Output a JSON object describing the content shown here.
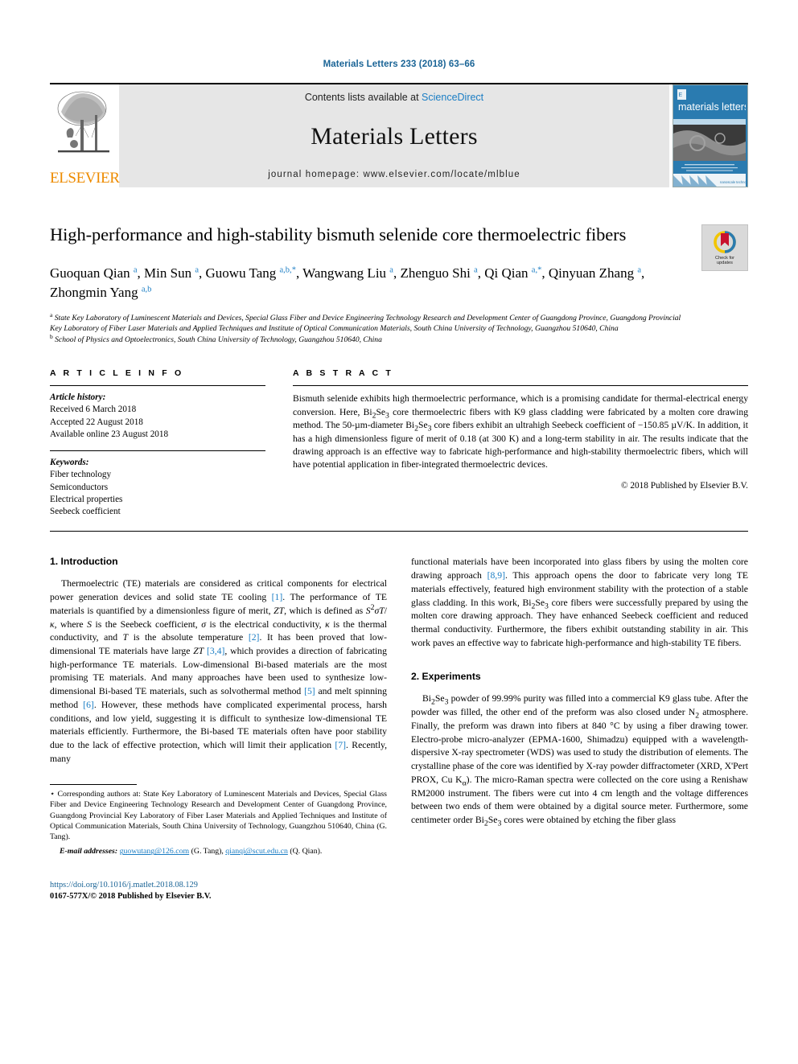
{
  "runhead": "Materials Letters 233 (2018) 63–66",
  "masthead": {
    "publisher": "ELSEVIER",
    "contents_prefix": "Contents lists available at ",
    "contents_link": "ScienceDirect",
    "journal_name": "Materials Letters",
    "homepage": "journal homepage: www.elsevier.com/locate/mlblue",
    "cover_title": "materials letters",
    "cover_footer": "nanoscale technology"
  },
  "article": {
    "title": "High-performance and high-stability bismuth selenide core thermoelectric fibers",
    "crossmark_label_line1": "Check for",
    "crossmark_label_line2": "updates",
    "authors_html": "Guoquan Qian <sup>a</sup>, Min Sun <sup>a</sup>, Guowu Tang <sup>a,b,</sup><sup>*</sup>, Wangwang Liu <sup>a</sup>, Zhenguo Shi <sup>a</sup>, Qi Qian <sup>a,</sup><sup>*</sup>, Qinyuan Zhang <sup>a</sup>, Zhongmin Yang <sup>a,b</sup>",
    "affiliation_a": "State Key Laboratory of Luminescent Materials and Devices, Special Glass Fiber and Device Engineering Technology Research and Development Center of Guangdong Province, Guangdong Provincial Key Laboratory of Fiber Laser Materials and Applied Techniques and Institute of Optical Communication Materials, South China University of Technology, Guangzhou 510640, China",
    "affiliation_b": "School of Physics and Optoelectronics, South China University of Technology, Guangzhou 510640, China"
  },
  "article_info": {
    "heading": "A R T I C L E   I N F O",
    "history_label": "Article history:",
    "history": [
      "Received 6 March 2018",
      "Accepted 22 August 2018",
      "Available online 23 August 2018"
    ],
    "keywords_label": "Keywords:",
    "keywords": [
      "Fiber technology",
      "Semiconductors",
      "Electrical properties",
      "Seebeck coefficient"
    ]
  },
  "abstract": {
    "heading": "A B S T R A C T",
    "text_html": "Bismuth selenide exhibits high thermoelectric performance, which is a promising candidate for thermal-electrical energy conversion. Here, Bi<sub>2</sub>Se<sub>3</sub> core thermoelectric fibers with K9 glass cladding were fabricated by a molten core drawing method. The 50-&micro;m-diameter Bi<sub>2</sub>Se<sub>3</sub> core fibers exhibit an ultrahigh Seebeck coefficient of &minus;150.85 &micro;V/K. In addition, it has a high dimensionless figure of merit of 0.18 (at 300 K) and a long-term stability in air. The results indicate that the drawing approach is an effective way to fabricate high-performance and high-stability thermoelectric fibers, which will have potential application in fiber-integrated thermoelectric devices.",
    "copyright": "© 2018 Published by Elsevier B.V."
  },
  "sections": {
    "intro_heading": "1. Introduction",
    "intro_p1_html": "Thermoelectric (TE) materials are considered as critical components for electrical power generation devices and solid state TE cooling <span class=\"ref\">[1]</span>. The performance of TE materials is quantified by a dimensionless figure of merit, <i>ZT</i>, which is defined as <i>S</i><sup>2</sup><i>&sigma;T</i>/<i>&kappa;</i>, where <i>S</i> is the Seebeck coefficient, <i>&sigma;</i> is the electrical conductivity, <i>&kappa;</i> is the thermal conductivity, and <i>T</i> is the absolute temperature <span class=\"ref\">[2]</span>. It has been proved that low-dimensional TE materials have large <i>ZT</i> <span class=\"ref\">[3,4]</span>, which provides a direction of fabricating high-performance TE materials. Low-dimensional Bi-based materials are the most promising TE materials. And many approaches have been used to synthesize low-dimensional Bi-based TE materials, such as solvothermal method <span class=\"ref\">[5]</span> and melt spinning method <span class=\"ref\">[6]</span>. However, these methods have complicated experimental process, harsh conditions, and low yield, suggesting it is difficult to synthesize low-dimensional TE materials efficiently. Furthermore, the Bi-based TE materials often have poor stability due to the lack of effective protection, which will limit their application <span class=\"ref\">[7]</span>. Recently, many",
    "intro_p2_html": "functional materials have been incorporated into glass fibers by using the molten core drawing approach <span class=\"ref\">[8,9]</span>. This approach opens the door to fabricate very long TE materials effectively, featured high environment stability with the protection of a stable glass cladding. In this work, Bi<sub>2</sub>Se<sub>3</sub> core fibers were successfully prepared by using the molten core drawing approach. They have enhanced Seebeck coefficient and reduced thermal conductivity. Furthermore, the fibers exhibit outstanding stability in air. This work paves an effective way to fabricate high-performance and high-stability TE fibers.",
    "exp_heading": "2. Experiments",
    "exp_p1_html": "Bi<sub>2</sub>Se<sub>3</sub> powder of 99.99% purity was filled into a commercial K9 glass tube. After the powder was filled, the other end of the preform was also closed under N<sub>2</sub> atmosphere. Finally, the preform was drawn into fibers at 840 &deg;C by using a fiber drawing tower. Electro-probe micro-analyzer (EPMA-1600, Shimadzu) equipped with a wavelength-dispersive X-ray spectrometer (WDS) was used to study the distribution of elements. The crystalline phase of the core was identified by X-ray powder diffractometer (XRD, X'Pert PROX, Cu K<sub>&alpha;</sub>). The micro-Raman spectra were collected on the core using a Renishaw RM2000 instrument. The fibers were cut into 4 cm length and the voltage differences between two ends of them were obtained by a digital source meter. Furthermore, some centimeter order Bi<sub>2</sub>Se<sub>3</sub> cores were obtained by etching the fiber glass"
  },
  "footnotes": {
    "corresponding_html": "<span class=\"ast\">&#8902;</span> Corresponding authors at: State Key Laboratory of Luminescent Materials and Devices, Special Glass Fiber and Device Engineering Technology Research and Development Center of Guangdong Province, Guangdong Provincial Key Laboratory of Fiber Laser Materials and Applied Techniques and Institute of Optical Communication Materials, South China University of Technology, Guangzhou 510640, China (G. Tang).",
    "email_label": "E-mail addresses:",
    "email_1": "guowutang@126.com",
    "email_1_owner": "(G. Tang),",
    "email_2": "qianqi@scut.edu.cn",
    "email_2_owner": "(Q. Qian)."
  },
  "footer": {
    "doi": "https://doi.org/10.1016/j.matlet.2018.08.129",
    "issn_line": "0167-577X/© 2018 Published by Elsevier B.V."
  },
  "colors": {
    "link": "#1a7dc4",
    "runhead": "#1a6496",
    "elsevier_orange": "#ED8B00",
    "cover_blue": "#2a7bb0",
    "band_grey": "#e6e6e6"
  }
}
